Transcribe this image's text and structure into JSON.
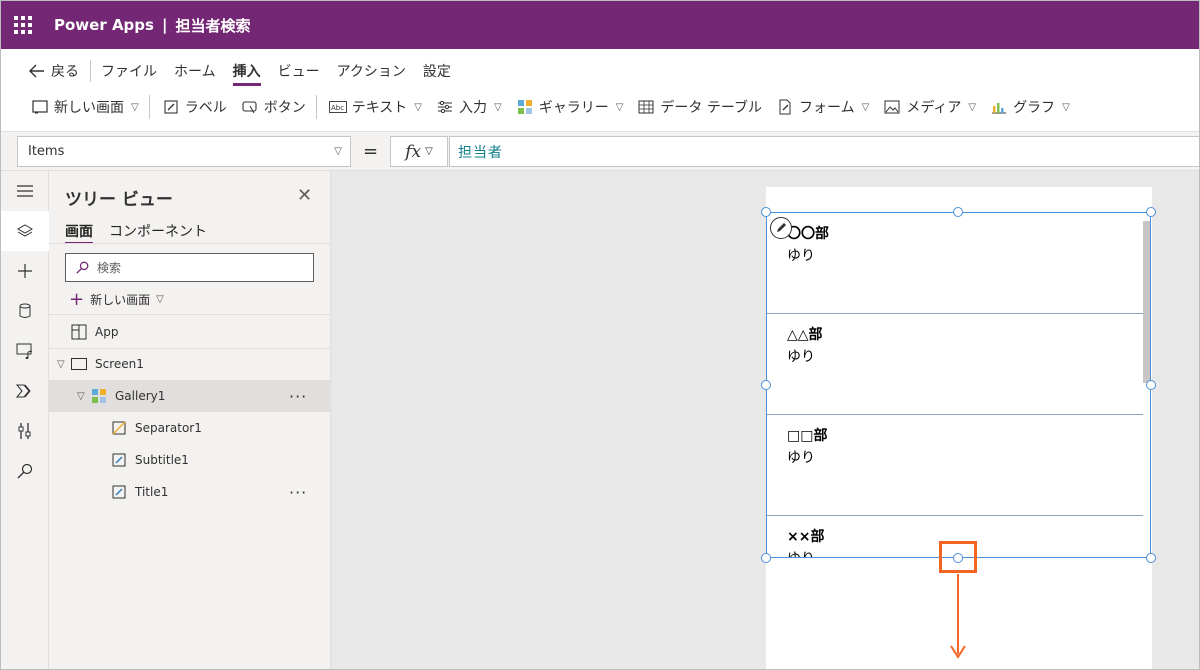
{
  "titlebar": {
    "app_name": "Power Apps",
    "separator": "|",
    "document_title": "担当者検索"
  },
  "menu": {
    "back_label": "戻る",
    "items": [
      "ファイル",
      "ホーム",
      "挿入",
      "ビュー",
      "アクション",
      "設定"
    ],
    "active": "挿入"
  },
  "ribbon": {
    "new_screen": "新しい画面",
    "label": "ラベル",
    "button": "ボタン",
    "text": "テキスト",
    "input": "入力",
    "gallery": "ギャラリー",
    "data_table": "データ テーブル",
    "form": "フォーム",
    "media": "メディア",
    "chart": "グラフ"
  },
  "formula_bar": {
    "property": "Items",
    "equals": "=",
    "fx": "fx",
    "formula": "担当者"
  },
  "tree": {
    "title": "ツリー ビュー",
    "tabs": [
      "画面",
      "コンポーネント"
    ],
    "search_placeholder": "検索",
    "new_screen": "新しい画面",
    "nodes": {
      "app": "App",
      "screen": "Screen1",
      "gallery": "Gallery1",
      "separator": "Separator1",
      "subtitle": "Subtitle1",
      "title": "Title1"
    },
    "more": "···"
  },
  "gallery": {
    "items": [
      {
        "title": "〇〇部",
        "subtitle": "ゆり"
      },
      {
        "title": "△△部",
        "subtitle": "ゆり"
      },
      {
        "title": "□□部",
        "subtitle": "ゆり"
      },
      {
        "title": "××部",
        "subtitle": "ゆり"
      }
    ]
  },
  "colors": {
    "brand": "#742774",
    "selection": "#4a90d9",
    "annotation": "#f26522",
    "formula_text": "#0f7f8c"
  }
}
